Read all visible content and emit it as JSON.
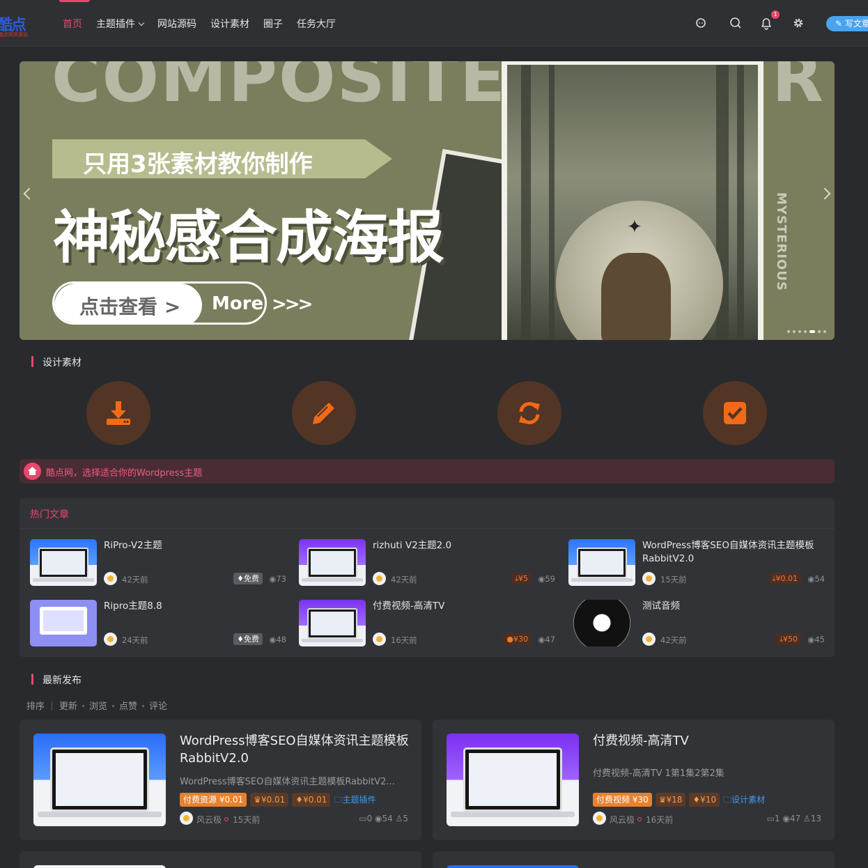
{
  "header": {
    "logo_text": "酷点",
    "logo_sub": "酷点网资源站",
    "nav": [
      {
        "label": "首页",
        "active": true
      },
      {
        "label": "主题插件",
        "dropdown": true
      },
      {
        "label": "网站源码"
      },
      {
        "label": "设计素材"
      },
      {
        "label": "圈子"
      },
      {
        "label": "任务大厅"
      }
    ],
    "icons": [
      "chat-icon",
      "search-icon",
      "bell-icon",
      "settings-icon"
    ],
    "notification_count": "1",
    "write_button": "写文章"
  },
  "banner": {
    "bg_word": "COMPOSITE",
    "bg_word_tail": "R",
    "ribbon": "只用3张素材教你制作",
    "headline": "神秘感合成海报",
    "cta_left": "点击查看 >",
    "cta_right": "More",
    "arrows": ">>>",
    "side_word": "MYSTERIOUS",
    "slide_count": 7,
    "active_slide": 5
  },
  "section_design": {
    "title": "设计素材",
    "icons": [
      "download-icon",
      "pencil-icon",
      "refresh-icon",
      "checkbox-icon"
    ]
  },
  "notice": {
    "text": "酷点网，选择适合你的Wordpress主题"
  },
  "hot": {
    "title": "热门文章",
    "items": [
      {
        "title": "RiPro-V2主题",
        "ago": "42天前",
        "price": "免费",
        "price_type": "free",
        "views": "73"
      },
      {
        "title": "rizhuti V2主题2.0",
        "ago": "42天前",
        "price": "¥5",
        "price_type": "pay",
        "views": "59"
      },
      {
        "title": "WordPress博客SEO自媒体资讯主题模板RabbitV2.0",
        "ago": "15天前",
        "price": "¥0.01",
        "price_type": "pay",
        "views": "54"
      },
      {
        "title": "Ripro主题8.8",
        "ago": "24天前",
        "price": "免费",
        "price_type": "free",
        "views": "48"
      },
      {
        "title": "付费视频-高清TV",
        "ago": "16天前",
        "price": "¥30",
        "price_type": "pay",
        "views": "47"
      },
      {
        "title": "测试音频",
        "ago": "42天前",
        "price": "¥50",
        "price_type": "pay",
        "views": "45"
      }
    ]
  },
  "latest": {
    "title": "最新发布",
    "sort_label": "排序",
    "sort_options": [
      "更新",
      "浏览",
      "点赞",
      "评论"
    ],
    "cards": [
      {
        "title": "WordPress博客SEO自媒体资讯主题模板RabbitV2.0",
        "excerpt": "WordPress博客SEO自媒体资讯主题模板RabbitV2...",
        "tag_main": "付费资源 ¥0.01",
        "tag_vip1": "¥0.01",
        "tag_vip2": "¥0.01",
        "category": "主题插件",
        "author": "风云极",
        "ago": "15天前",
        "comments": "0",
        "views": "54",
        "likes": "5"
      },
      {
        "title": "付费视频-高清TV",
        "excerpt": "付费视频-高清TV 1第1集2第2集",
        "tag_main": "付费视频 ¥30",
        "tag_vip1": "¥18",
        "tag_vip2": "¥10",
        "category": "设计素材",
        "author": "风云极",
        "ago": "16天前",
        "comments": "1",
        "views": "47",
        "likes": "13"
      }
    ]
  },
  "colors": {
    "accent": "#e8476d",
    "price": "#f07a2d",
    "link": "#3f9bf0",
    "bg": "#292a2d",
    "card": "#323337"
  }
}
